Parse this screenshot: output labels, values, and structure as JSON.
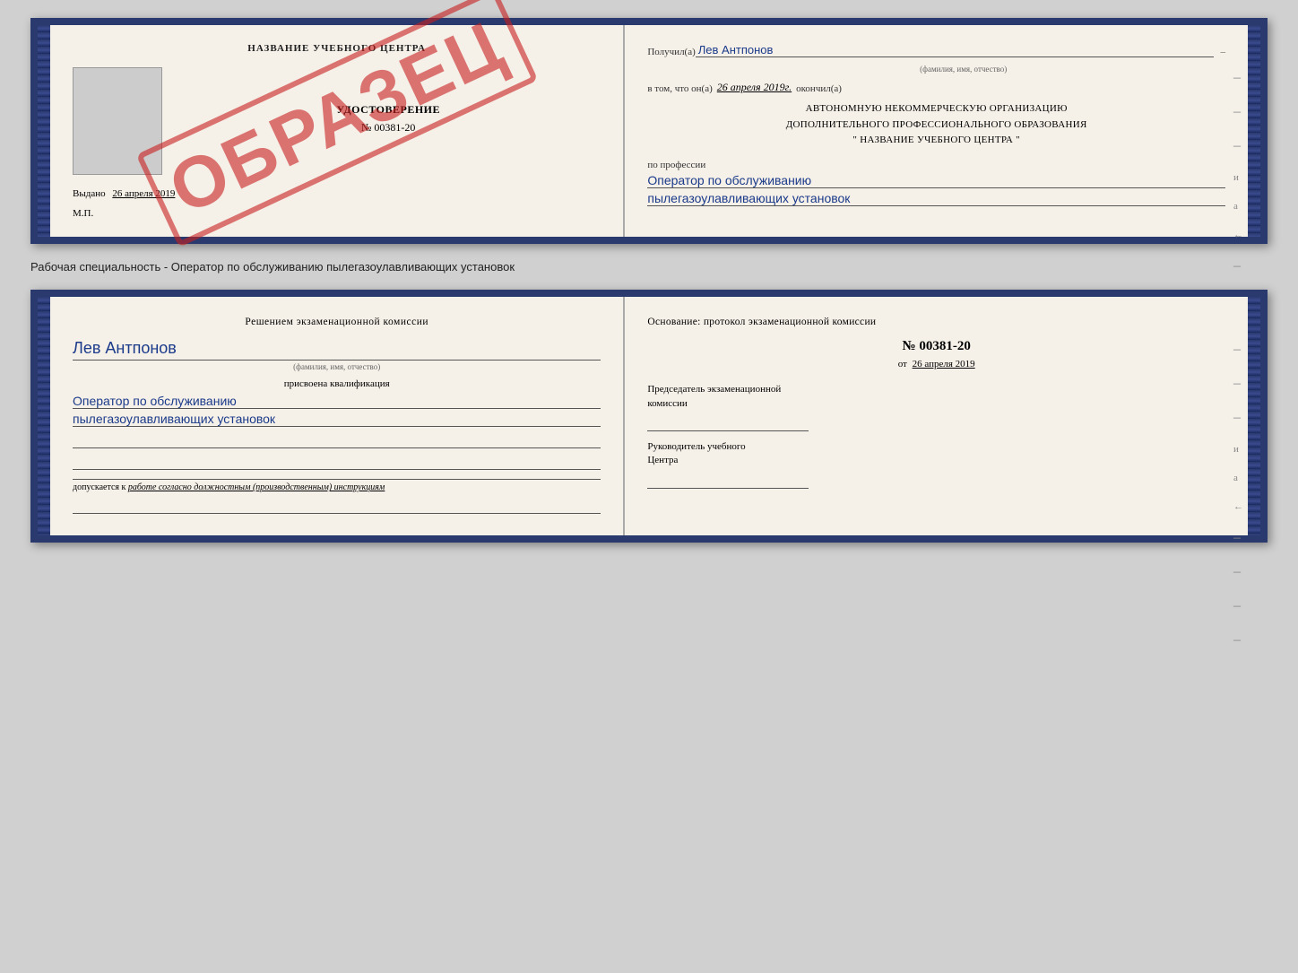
{
  "page": {
    "background_color": "#d0d0d0"
  },
  "top_booklet": {
    "left": {
      "header": "НАЗВАНИЕ УЧЕБНОГО ЦЕНТРА",
      "cert_title": "УДОСТОВЕРЕНИЕ",
      "cert_number": "№ 00381-20",
      "issued_label": "Выдано",
      "issued_date": "26 апреля 2019",
      "mp_label": "М.П.",
      "obrazets": "ОБРАЗЕЦ"
    },
    "right": {
      "received_label": "Получил(а)",
      "person_name": "Лев Антпонов",
      "fio_hint": "(фамилия, имя, отчество)",
      "date_prefix": "в том, что он(а)",
      "date_value": "26 апреля 2019г.",
      "finished_label": "окончил(а)",
      "org_line1": "АВТОНОМНУЮ НЕКОММЕРЧЕСКУЮ ОРГАНИЗАЦИЮ",
      "org_line2": "ДОПОЛНИТЕЛЬНОГО ПРОФЕССИОНАЛЬНОГО ОБРАЗОВАНИЯ",
      "org_line3": "\"  НАЗВАНИЕ УЧЕБНОГО ЦЕНТРА  \"",
      "profession_label": "по профессии",
      "profession_line1": "Оператор по обслуживанию",
      "profession_line2": "пылегазоулавливающих установок"
    }
  },
  "middle_text": "Рабочая специальность - Оператор по обслуживанию пылегазоулавливающих установок",
  "bottom_booklet": {
    "left": {
      "section_title_line1": "Решением экзаменационной комиссии",
      "person_name": "Лев Антпонов",
      "fio_hint": "(фамилия, имя, отчество)",
      "qual_label": "присвоена квалификация",
      "qual_line1": "Оператор по обслуживанию",
      "qual_line2": "пылегазоулавливающих установок",
      "work_permit_prefix": "допускается к",
      "work_permit_text": "работе согласно должностным (производственным) инструкциям"
    },
    "right": {
      "basis_title": "Основание: протокол экзаменационной комиссии",
      "protocol_number": "№  00381-20",
      "protocol_date_prefix": "от",
      "protocol_date": "26 апреля 2019",
      "chairman_title_line1": "Председатель экзаменационной",
      "chairman_title_line2": "комиссии",
      "director_title_line1": "Руководитель учебного",
      "director_title_line2": "Центра"
    }
  }
}
